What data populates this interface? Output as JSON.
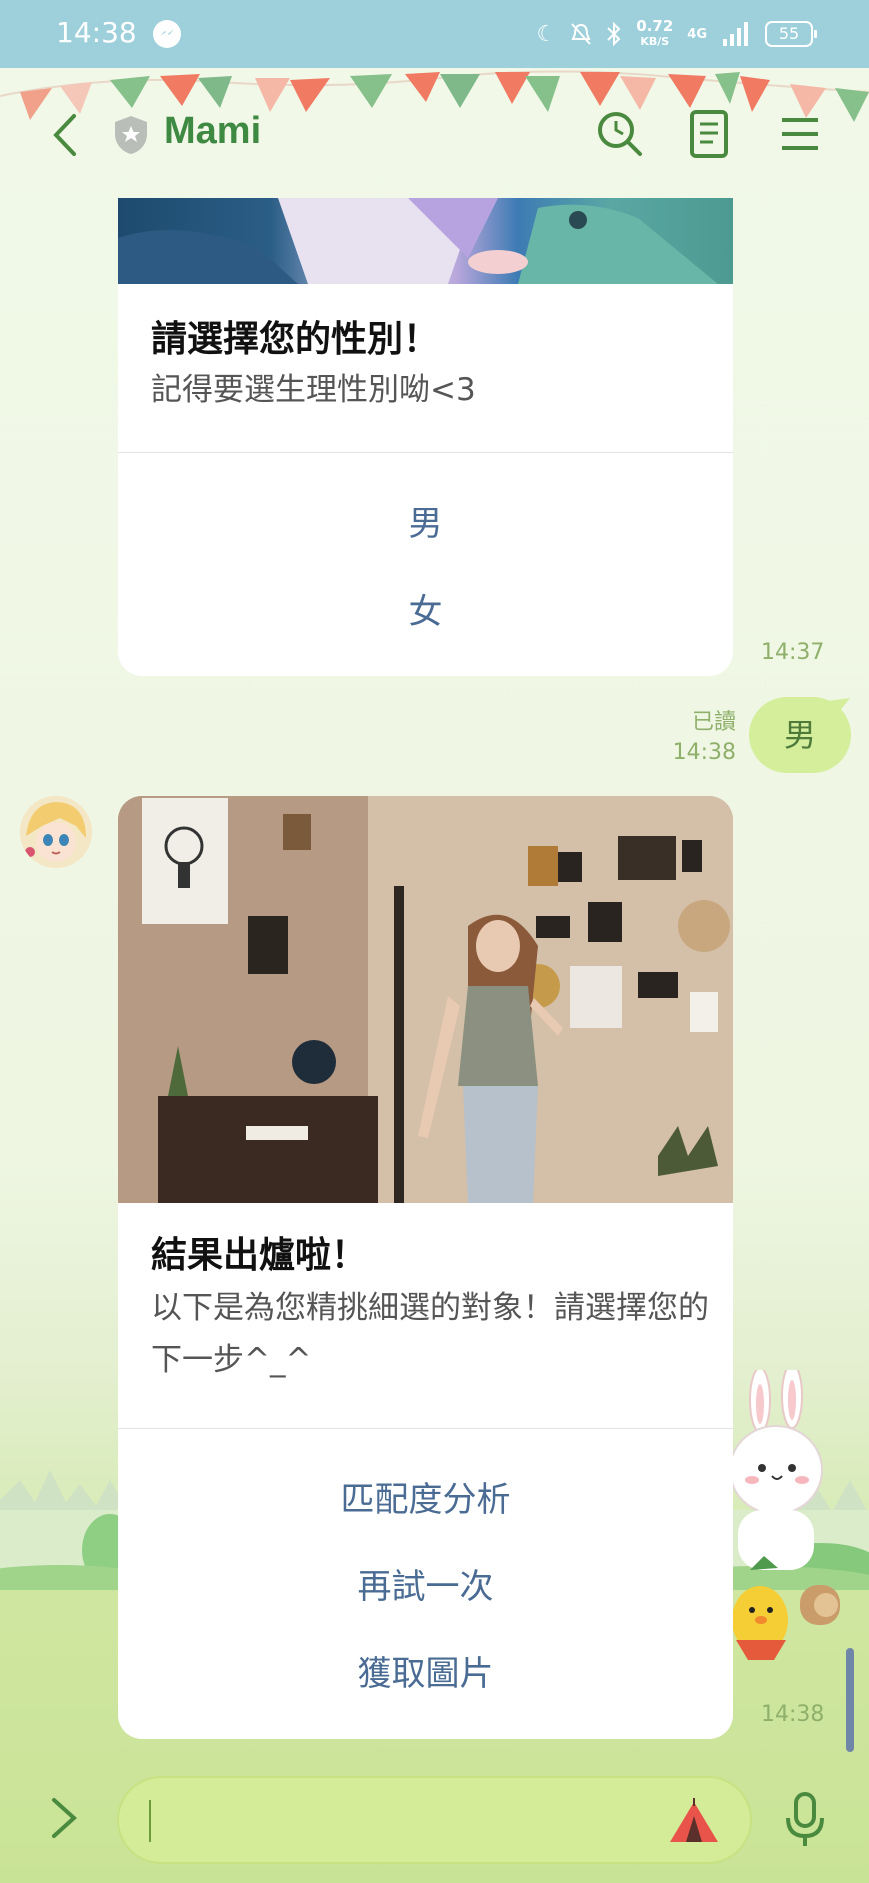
{
  "status_bar": {
    "time": "14:38",
    "speed_value": "0.72",
    "speed_unit": "KB/S",
    "network": "4G",
    "battery": "55"
  },
  "header": {
    "title": "Mami"
  },
  "messages": {
    "card1": {
      "title": "請選擇您的性別！",
      "subtitle": "記得要選生理性別呦<3",
      "actions": [
        "男",
        "女"
      ],
      "time": "14:37"
    },
    "my_reply": {
      "text": "男",
      "read_label": "已讀",
      "time": "14:38"
    },
    "card2": {
      "title": "結果出爐啦！",
      "subtitle": "以下是為您精挑細選的對象！請選擇您的下一步^_^",
      "actions": [
        "匹配度分析",
        "再試一次",
        "獲取圖片"
      ],
      "time": "14:38"
    }
  },
  "colors": {
    "status_bar": "#9ed0dc",
    "title_green": "#3f8a43",
    "action_blue": "#4a6b93",
    "bubble_green": "#d4ee9c"
  },
  "icons": {
    "back": "chevron-left-icon",
    "official": "shield-icon",
    "search": "search-clock-icon",
    "notes": "notes-icon",
    "menu": "hamburger-icon",
    "expand": "chevron-right-icon",
    "sticker": "tent-icon",
    "mic": "microphone-icon"
  }
}
